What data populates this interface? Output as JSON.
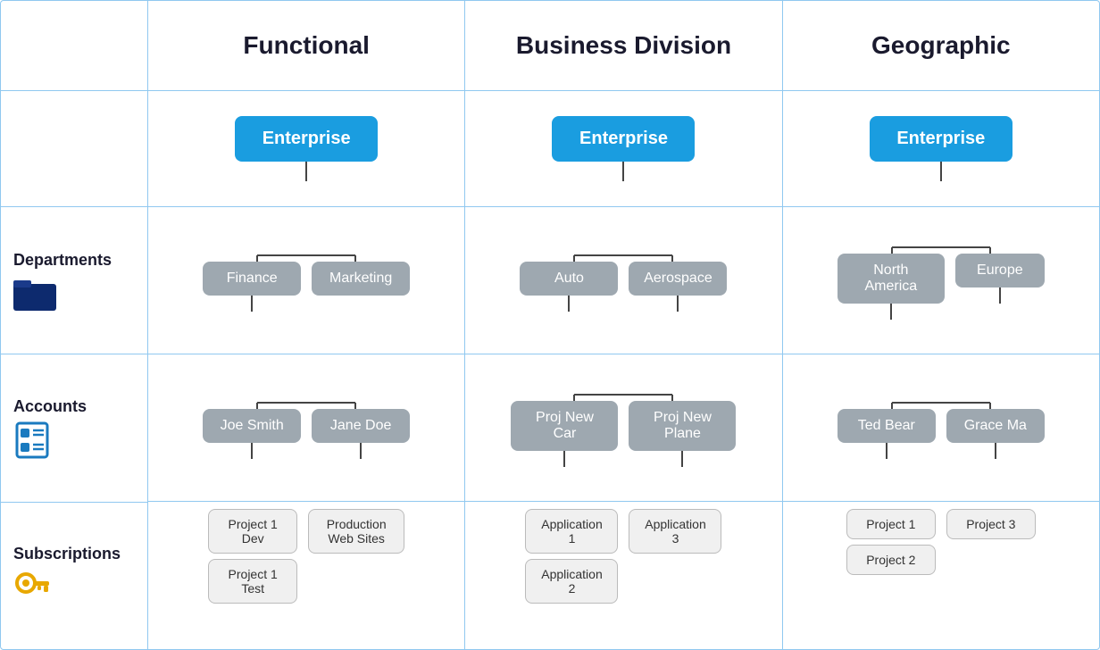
{
  "headers": {
    "spacer": "",
    "col1": "Functional",
    "col2": "Business Division",
    "col3": "Geographic"
  },
  "labels": {
    "departments": "Departments",
    "accounts": "Accounts",
    "subscriptions": "Subscriptions"
  },
  "functional": {
    "enterprise": "Enterprise",
    "dept1": "Finance",
    "dept2": "Marketing",
    "account1": "Joe Smith",
    "account2": "Jane Doe",
    "sub1": "Project 1 Dev",
    "sub2": "Project 1 Test",
    "sub3": "Production Web Sites"
  },
  "business": {
    "enterprise": "Enterprise",
    "dept1": "Auto",
    "dept2": "Aerospace",
    "account1": "Proj New Car",
    "account2": "Proj New Plane",
    "sub1": "Application 1",
    "sub2": "Application 2",
    "sub3": "Application 3"
  },
  "geographic": {
    "enterprise": "Enterprise",
    "dept1": "North America",
    "dept2": "Europe",
    "account1": "Ted Bear",
    "account2": "Grace Ma",
    "sub1": "Project 1",
    "sub2": "Project 2",
    "sub3": "Project 3"
  }
}
